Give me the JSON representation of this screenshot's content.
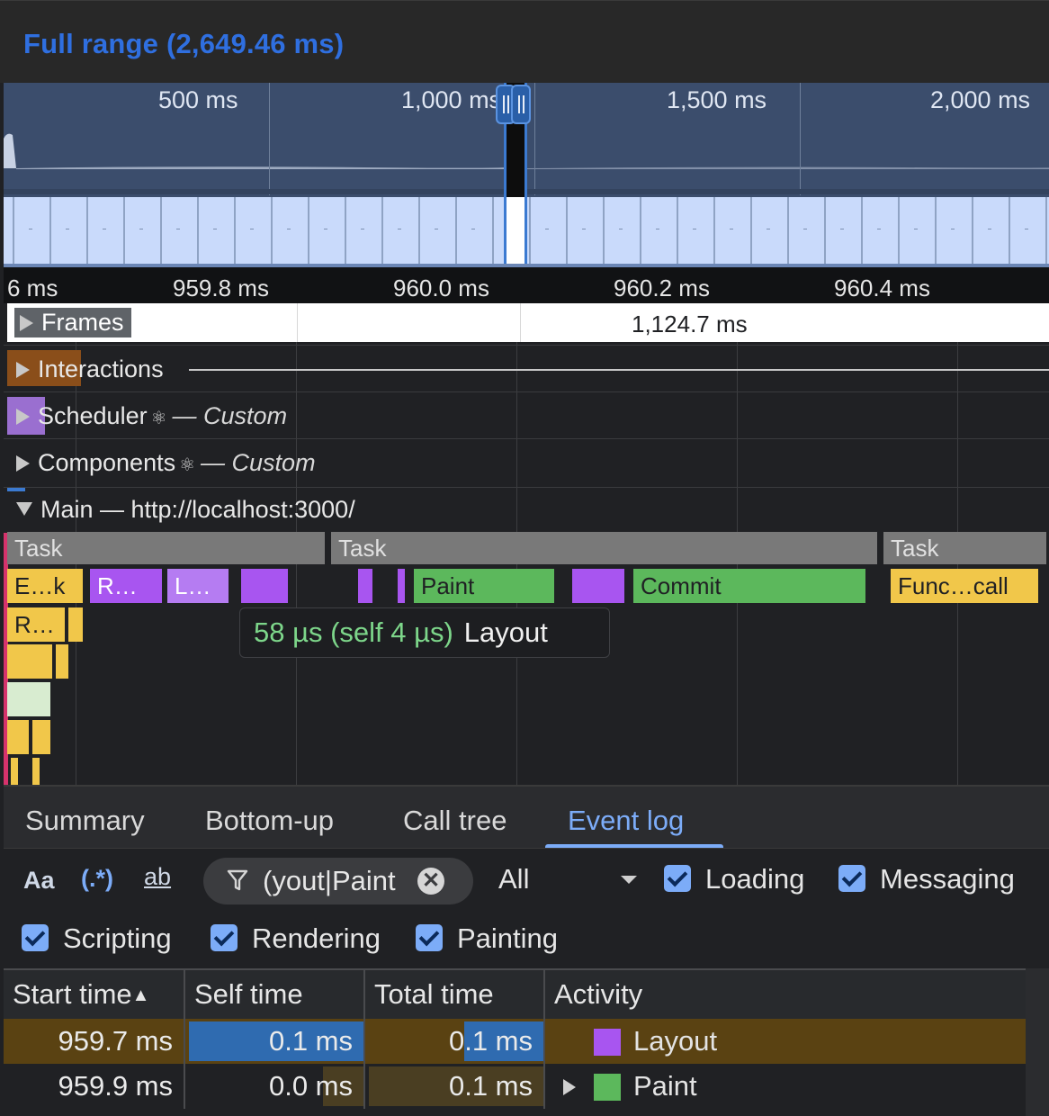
{
  "header": {
    "title": "Full range (2,649.46 ms)"
  },
  "overview": {
    "ticks": [
      "500 ms",
      "1,000 ms",
      "1,500 ms",
      "2,000 ms"
    ]
  },
  "ruler": {
    "ticks": [
      "6 ms",
      "959.8 ms",
      "960.0 ms",
      "960.2 ms",
      "960.4 ms"
    ]
  },
  "tracks": {
    "frames": {
      "label": "Frames",
      "duration": "1,124.7 ms"
    },
    "interactions": {
      "label": "Interactions"
    },
    "scheduler": {
      "label": "Scheduler",
      "suffix": "— Custom"
    },
    "components": {
      "label": "Components",
      "suffix": "— Custom"
    },
    "main": {
      "label": "Main — http://localhost:3000/"
    },
    "tasks": [
      "Task",
      "Task",
      "Task"
    ],
    "events": {
      "e1": "E…k",
      "r1": "R…",
      "l1": "L…",
      "paint": "Paint",
      "commit": "Commit",
      "func": "Func…call",
      "r2": "R…"
    },
    "tooltip": {
      "time": "58 µs (self 4 µs)",
      "name": "Layout"
    }
  },
  "tabs": [
    {
      "label": "Summary",
      "active": false
    },
    {
      "label": "Bottom-up",
      "active": false
    },
    {
      "label": "Call tree",
      "active": false
    },
    {
      "label": "Event log",
      "active": true
    }
  ],
  "filters": {
    "match_case": "Aa",
    "regex": "(.*)",
    "whole_word": "ab",
    "filter_value": "yout|Paint)",
    "duration_select": "All",
    "checkboxes": [
      {
        "label": "Loading",
        "checked": true
      },
      {
        "label": "Messaging",
        "checked": true
      },
      {
        "label": "Scripting",
        "checked": true
      },
      {
        "label": "Rendering",
        "checked": true
      },
      {
        "label": "Painting",
        "checked": true
      }
    ]
  },
  "table": {
    "columns": [
      "Start time",
      "Self time",
      "Total time",
      "Activity"
    ],
    "sort_indicator": "▲",
    "rows": [
      {
        "start": "959.7 ms",
        "self": "0.1 ms",
        "total": "0.1 ms",
        "activity": "Layout",
        "color": "#a855f0",
        "selected": true,
        "self_fraction": 1.0,
        "total_fraction": 0.46
      },
      {
        "start": "959.9 ms",
        "self": "0.0 ms",
        "total": "0.1 ms",
        "activity": "Paint",
        "color": "#5cb85c",
        "selected": false,
        "expandable": true,
        "self_fraction": 0.24,
        "total_fraction": 1.0
      }
    ]
  },
  "colors": {
    "accent": "#7cacf8",
    "title": "#2f6fe0",
    "scripting": "#f1c74a",
    "rendering": "#a855f0",
    "painting": "#5cb85c"
  }
}
